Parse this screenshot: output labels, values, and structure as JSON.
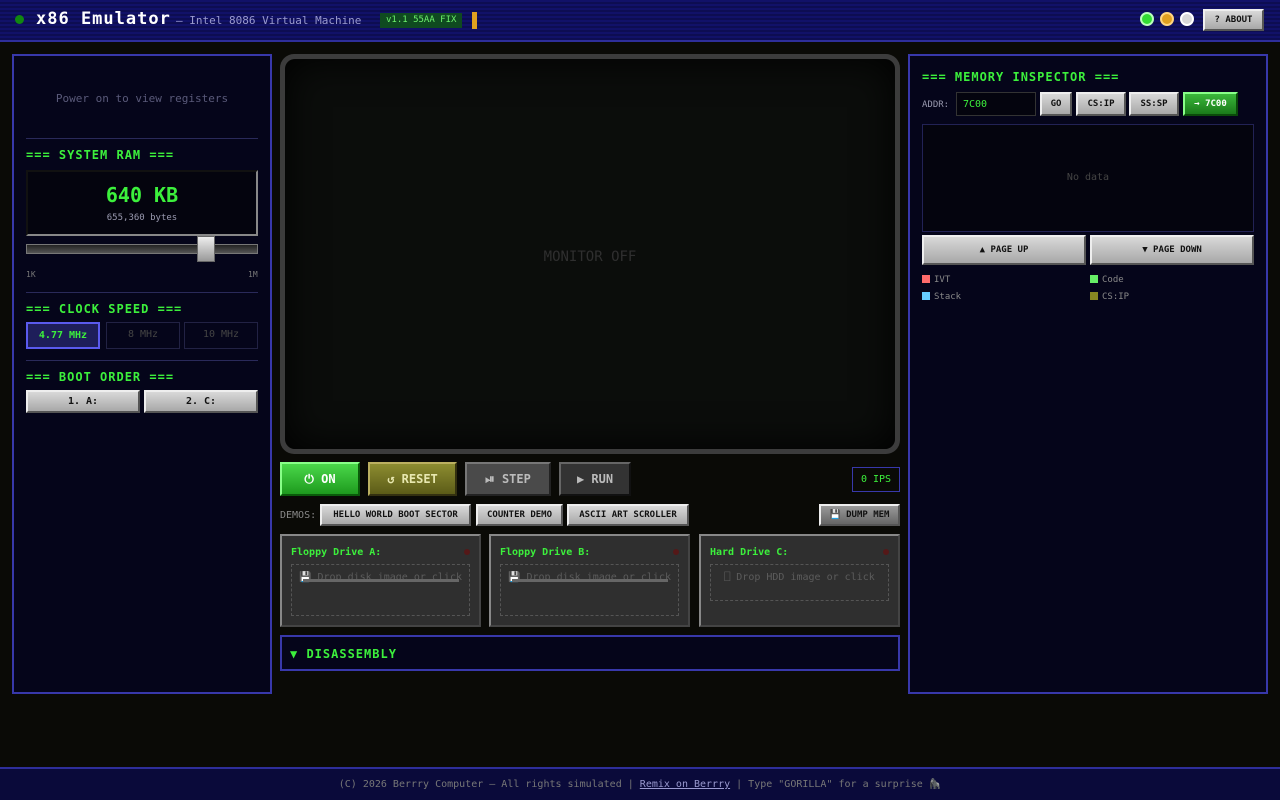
{
  "header": {
    "title": "x86 Emulator",
    "subtitle": "— Intel 8086 Virtual Machine",
    "version": "v1.1 55AA FIX",
    "about_label": "? ABOUT"
  },
  "left": {
    "registers_msg": "Power on to view registers",
    "ram": {
      "title": "=== SYSTEM RAM ===",
      "value": "640 KB",
      "bytes": "655,360 bytes",
      "min_label": "1K",
      "max_label": "1M",
      "slider_level": 0.8
    },
    "clock": {
      "title": "=== CLOCK SPEED ===",
      "options": [
        "4.77 MHz",
        "8 MHz",
        "10 MHz"
      ],
      "selected": "4.77 MHz"
    },
    "boot": {
      "title": "=== BOOT ORDER ===",
      "items": [
        "1. A:",
        "2. C:"
      ]
    }
  },
  "monitor": {
    "status": "MONITOR OFF"
  },
  "controls": {
    "on": "⏻ ON",
    "reset": "↺ RESET",
    "step": "⏯ STEP",
    "run": "▶ RUN",
    "ips": "0 IPS"
  },
  "demos": {
    "label": "DEMOS:",
    "items": [
      "HELLO WORLD BOOT SECTOR",
      "COUNTER DEMO",
      "ASCII ART SCROLLER"
    ],
    "dump_label": "💾 DUMP MEM"
  },
  "drives": [
    {
      "title": "Floppy Drive A:",
      "hint": "💾 Drop disk image or click"
    },
    {
      "title": "Floppy Drive B:",
      "hint": "💾 Drop disk image or click"
    },
    {
      "title": "Hard Drive C:",
      "hint": "⎕ Drop HDD image or click"
    }
  ],
  "disassembly": {
    "label": "▼ DISASSEMBLY"
  },
  "memory": {
    "title": "=== MEMORY INSPECTOR ===",
    "addr_label": "ADDR:",
    "addr_value": "7C00",
    "go": "GO",
    "cs_ip": "CS:IP",
    "ss_sp": "SS:SP",
    "jump": "→ 7C00",
    "no_data": "No data",
    "page_up": "▲ PAGE UP",
    "page_down": "▼ PAGE DOWN",
    "legend": [
      {
        "label": "IVT",
        "color": "#ff6b6b"
      },
      {
        "label": "Code",
        "color": "#66ee66"
      },
      {
        "label": "Stack",
        "color": "#66ccff"
      },
      {
        "label": "CS:IP",
        "color": "#888822"
      }
    ]
  },
  "footer": {
    "copyright": "(C) 2026 Berrry Computer — All rights simulated |",
    "link": "Remix on Berrry",
    "tail": "| Type \"GORILLA\" for a surprise 🦍"
  }
}
